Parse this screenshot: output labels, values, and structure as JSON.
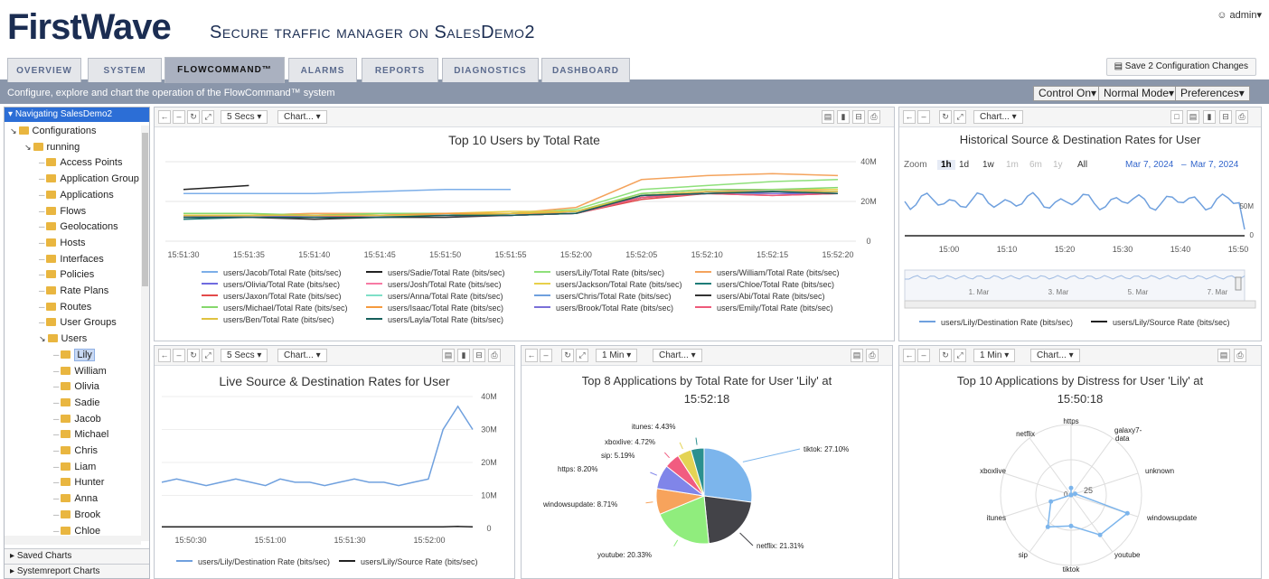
{
  "header": {
    "logo": "FirstWave",
    "subtitle": "Secure traffic manager on SalesDemo2",
    "user": "admin"
  },
  "tabs": [
    {
      "label": "OVERVIEW"
    },
    {
      "label": "SYSTEM"
    },
    {
      "label": "FLOWCOMMAND™"
    },
    {
      "label": "ALARMS"
    },
    {
      "label": "REPORTS"
    },
    {
      "label": "DIAGNOSTICS"
    },
    {
      "label": "DASHBOARD"
    }
  ],
  "save_button": "Save 2 Configuration Changes",
  "description": "Configure, explore and chart the operation of the FlowCommand™ system",
  "controls": {
    "control": "Control On",
    "mode": "Normal Mode",
    "prefs": "Preferences"
  },
  "sidebar": {
    "header": "Navigating SalesDemo2",
    "tree": [
      "Configurations",
      "running",
      "Access Points",
      "Application Group",
      "Applications",
      "Flows",
      "Geolocations",
      "Hosts",
      "Interfaces",
      "Policies",
      "Rate Plans",
      "Routes",
      "User Groups",
      "Users",
      "Lily",
      "William",
      "Olivia",
      "Sadie",
      "Jacob",
      "Michael",
      "Chris",
      "Liam",
      "Hunter",
      "Anna",
      "Brook",
      "Chloe"
    ],
    "saved": "Saved Charts",
    "sysreport": "Systemreport Charts"
  },
  "toolbar": {
    "interval_5": "5 Secs",
    "interval_1m": "1 Min",
    "chart": "Chart..."
  },
  "panels": {
    "p1": {
      "title": "Top 10 Users by Total Rate"
    },
    "p2": {
      "title": "Historical Source & Destination Rates for User",
      "zoom_label": "Zoom",
      "zoom_buttons": [
        "1h",
        "1d",
        "1w",
        "1m",
        "6m",
        "1y",
        "All"
      ],
      "date_from": "Mar 7, 2024",
      "date_sep": "–",
      "date_to": "Mar 7, 2024",
      "nav_labels": [
        "1. Mar",
        "3. Mar",
        "5. Mar",
        "7. Mar"
      ]
    },
    "p3": {
      "title": "Live Source & Destination Rates for User"
    },
    "p4": {
      "title": "Top 8 Applications by Total Rate for User 'Lily' at",
      "time": "15:52:18"
    },
    "p5": {
      "title": "Top 10 Applications by Distress for User 'Lily' at",
      "time": "15:50:18",
      "r_label": "25"
    }
  },
  "chart_data": [
    {
      "type": "line",
      "title": "Top 10 Users by Total Rate",
      "x": [
        "15:51:30",
        "15:51:35",
        "15:51:40",
        "15:51:45",
        "15:51:50",
        "15:51:55",
        "15:52:00",
        "15:52:05",
        "15:52:10",
        "15:52:15",
        "15:52:20"
      ],
      "y_ticks": [
        "40M",
        "20M",
        "0"
      ],
      "ylim": [
        0,
        40
      ],
      "series": [
        {
          "name": "users/Jacob/Total Rate (bits/sec)",
          "color": "#7caee8",
          "values": [
            24,
            24,
            24,
            25,
            26,
            26,
            null,
            null,
            null,
            null,
            null
          ]
        },
        {
          "name": "users/Sadie/Total Rate (bits/sec)",
          "color": "#222222",
          "values": [
            26,
            28,
            null,
            null,
            null,
            null,
            null,
            null,
            null,
            null,
            null
          ]
        },
        {
          "name": "users/Lily/Total Rate (bits/sec)",
          "color": "#8ee07a",
          "values": [
            12,
            13,
            14,
            13,
            13,
            14,
            16,
            26,
            28,
            30,
            31
          ]
        },
        {
          "name": "users/William/Total Rate (bits/sec)",
          "color": "#f4a35c",
          "values": [
            13,
            13,
            14,
            14,
            13,
            14,
            17,
            31,
            33,
            34,
            33
          ]
        },
        {
          "name": "users/Olivia/Total Rate (bits/sec)",
          "color": "#6f6be0",
          "values": [
            12,
            12,
            13,
            13,
            13,
            14,
            15,
            22,
            25,
            25,
            25
          ]
        },
        {
          "name": "users/Josh/Total Rate (bits/sec)",
          "color": "#f77aa4",
          "values": [
            13,
            12,
            13,
            13,
            14,
            14,
            15,
            23,
            25,
            26,
            25
          ]
        },
        {
          "name": "users/Jackson/Total Rate (bits/sec)",
          "color": "#e8d04a",
          "values": [
            13,
            13,
            13,
            14,
            14,
            15,
            15,
            24,
            26,
            26,
            26
          ]
        },
        {
          "name": "users/Chloe/Total Rate (bits/sec)",
          "color": "#1e7c78",
          "values": [
            11,
            12,
            12,
            12,
            13,
            13,
            14,
            22,
            24,
            24,
            24
          ]
        },
        {
          "name": "users/Jaxon/Total Rate (bits/sec)",
          "color": "#e34a4a",
          "values": [
            12,
            12,
            13,
            13,
            13,
            13,
            14,
            21,
            24,
            23,
            24
          ]
        },
        {
          "name": "users/Anna/Total Rate (bits/sec)",
          "color": "#7ee0c8",
          "values": [
            13,
            13,
            13,
            13,
            13,
            14,
            15,
            23,
            25,
            25,
            25
          ]
        },
        {
          "name": "users/Chris/Total Rate (bits/sec)",
          "color": "#6fa0de",
          "values": [
            12,
            12,
            12,
            13,
            13,
            13,
            14,
            22,
            24,
            24,
            24
          ]
        },
        {
          "name": "users/Abi/Total Rate (bits/sec)",
          "color": "#333333",
          "values": [
            12,
            12,
            11,
            12,
            12,
            13,
            14,
            23,
            24,
            25,
            24
          ]
        },
        {
          "name": "users/Michael/Total Rate (bits/sec)",
          "color": "#86d86c",
          "values": [
            14,
            14,
            13,
            14,
            14,
            14,
            15,
            24,
            26,
            26,
            27
          ]
        },
        {
          "name": "users/Isaac/Total Rate (bits/sec)",
          "color": "#f59a3e",
          "values": [
            13,
            13,
            13,
            13,
            14,
            14,
            14,
            22,
            25,
            24,
            24
          ]
        },
        {
          "name": "users/Brook/Total Rate (bits/sec)",
          "color": "#7a70d8",
          "values": [
            12,
            12,
            13,
            13,
            13,
            13,
            14,
            22,
            25,
            24,
            24
          ]
        },
        {
          "name": "users/Emily/Total Rate (bits/sec)",
          "color": "#ee5a7a",
          "values": [
            12,
            12,
            12,
            13,
            13,
            13,
            14,
            22,
            24,
            23,
            24
          ]
        },
        {
          "name": "users/Ben/Total Rate (bits/sec)",
          "color": "#e0c240",
          "values": [
            13,
            13,
            13,
            13,
            13,
            14,
            15,
            23,
            25,
            25,
            25
          ]
        },
        {
          "name": "users/Layla/Total Rate (bits/sec)",
          "color": "#165f5b",
          "values": [
            12,
            12,
            12,
            12,
            13,
            13,
            14,
            23,
            24,
            25,
            24
          ]
        }
      ]
    },
    {
      "type": "line",
      "title": "Historical Source & Destination Rates for User",
      "x": [
        "15:00",
        "15:10",
        "15:20",
        "15:30",
        "15:40",
        "15:50"
      ],
      "y_ticks": [
        "50M",
        "0"
      ],
      "series": [
        {
          "name": "users/Lily/Destination Rate (bits/sec)",
          "color": "#6fa0de"
        },
        {
          "name": "users/Lily/Source Rate (bits/sec)",
          "color": "#222222"
        }
      ]
    },
    {
      "type": "line",
      "title": "Live Source & Destination Rates for User",
      "x": [
        "15:50:30",
        "15:51:00",
        "15:51:30",
        "15:52:00"
      ],
      "y_ticks": [
        "40M",
        "30M",
        "20M",
        "10M",
        "0"
      ],
      "ylim": [
        0,
        40
      ],
      "series": [
        {
          "name": "users/Lily/Destination Rate (bits/sec)",
          "color": "#6fa0de",
          "values": [
            14,
            15,
            14,
            13,
            14,
            15,
            14,
            13,
            15,
            14,
            14,
            13,
            14,
            15,
            14,
            14,
            13,
            14,
            15,
            30,
            37,
            30
          ]
        },
        {
          "name": "users/Lily/Source Rate (bits/sec)",
          "color": "#222222",
          "values": [
            0.5,
            0.5,
            0.5,
            0.5,
            0.5,
            0.5,
            0.5,
            0.5,
            0.5,
            0.5,
            0.5,
            0.5,
            0.5,
            0.5,
            0.5,
            0.5,
            0.5,
            0.5,
            0.5,
            0.5,
            0.6,
            0.5
          ]
        }
      ]
    },
    {
      "type": "pie",
      "title": "Top 8 Applications by Total Rate for User 'Lily' at 15:52:18",
      "slices": [
        {
          "label": "tiktok: 27.10%",
          "value": 27.1,
          "color": "#7cb5ec"
        },
        {
          "label": "netflix: 21.31%",
          "value": 21.31,
          "color": "#434348"
        },
        {
          "label": "youtube: 20.33%",
          "value": 20.33,
          "color": "#90ed7d"
        },
        {
          "label": "windowsupdate: 8.71%",
          "value": 8.71,
          "color": "#f7a35c"
        },
        {
          "label": "https: 8.20%",
          "value": 8.2,
          "color": "#8085e9"
        },
        {
          "label": "sip: 5.19%",
          "value": 5.19,
          "color": "#f15c80"
        },
        {
          "label": "xboxlive: 4.72%",
          "value": 4.72,
          "color": "#e4d354"
        },
        {
          "label": "itunes: 4.43%",
          "value": 4.43,
          "color": "#2b908f"
        }
      ]
    },
    {
      "type": "radar",
      "title": "Top 10 Applications by Distress for User 'Lily' at 15:50:18",
      "axes": [
        "https",
        "galaxy7-data",
        "unknown",
        "windowsupdate",
        "youtube",
        "tiktok",
        "sip",
        "itunes",
        "xboxlive",
        "netflix"
      ],
      "values": [
        5,
        0,
        3,
        42,
        35,
        22,
        28,
        15,
        0,
        0
      ],
      "r_tick": "25",
      "color": "#7cb5ec"
    }
  ]
}
